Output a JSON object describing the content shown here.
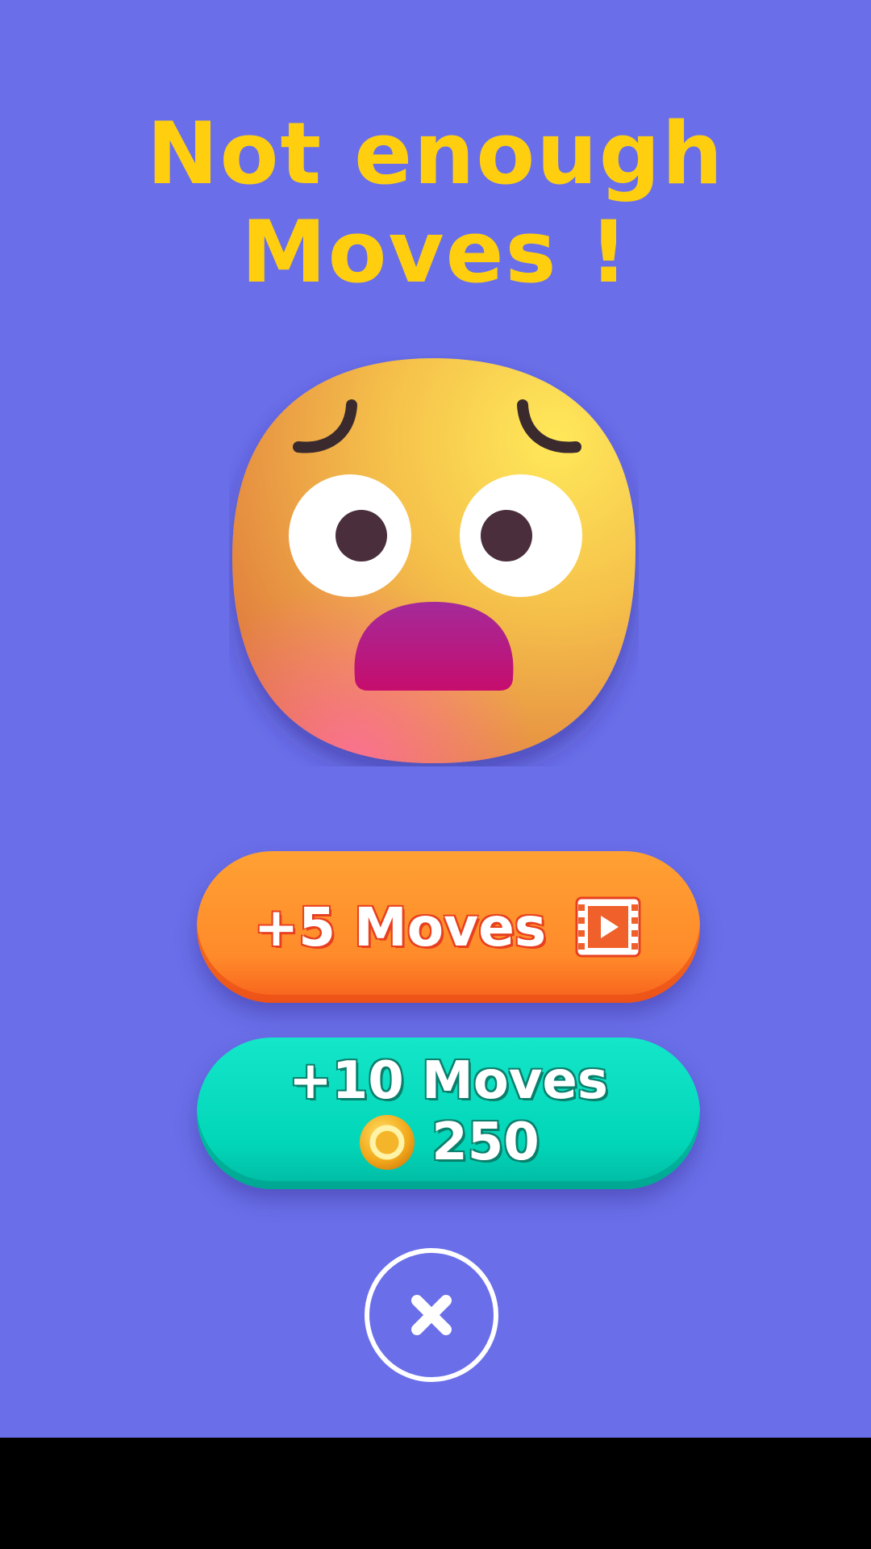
{
  "title": {
    "line1": "Not enough",
    "line2": "Moves !"
  },
  "emoji": {
    "icon": "worried-face-icon"
  },
  "ad_button": {
    "label": "+5 Moves",
    "icon": "film-video-icon"
  },
  "coin_button": {
    "label": "+10 Moves",
    "price": "250",
    "icon": "coin-icon"
  },
  "close_button": {
    "icon": "close-icon"
  },
  "colors": {
    "background": "#6a6fe9",
    "title": "#ffcf0f",
    "ad_button": "#ff8a2a",
    "coin_button": "#02d6b8"
  }
}
